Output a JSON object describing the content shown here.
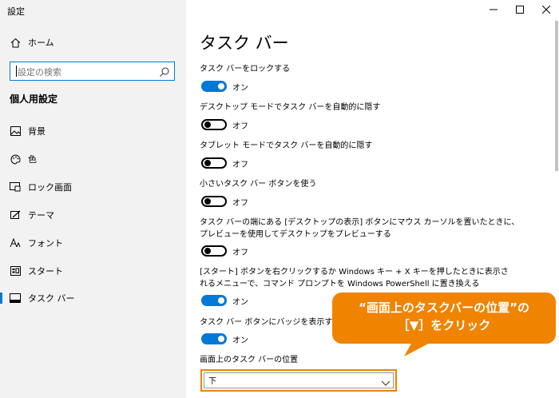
{
  "window": {
    "title": "設定"
  },
  "sidebar": {
    "home_label": "ホーム",
    "search_placeholder": "設定の検索",
    "section_title": "個人用設定",
    "items": [
      {
        "label": "背景",
        "icon": "picture-icon"
      },
      {
        "label": "色",
        "icon": "palette-icon"
      },
      {
        "label": "ロック画面",
        "icon": "lock-screen-icon"
      },
      {
        "label": "テーマ",
        "icon": "theme-icon"
      },
      {
        "label": "フォント",
        "icon": "font-icon"
      },
      {
        "label": "スタート",
        "icon": "start-icon"
      },
      {
        "label": "タスク バー",
        "icon": "taskbar-icon",
        "active": true
      }
    ]
  },
  "main": {
    "title": "タスク バー",
    "settings": [
      {
        "label": "タスク バーをロックする",
        "state": "オン"
      },
      {
        "label": "デスクトップ モードでタスク バーを自動的に隠す",
        "state": "オフ"
      },
      {
        "label": "タブレット モードでタスク バーを自動的に隠す",
        "state": "オフ"
      },
      {
        "label": "小さいタスク バー ボタンを使う",
        "state": "オフ"
      },
      {
        "label_lines": [
          "タスク バーの端にある [デスクトップの表示] ボタンにマウス カーソルを置いたときに、",
          "プレビューを使用してデスクトップをプレビューする"
        ],
        "state": "オフ"
      },
      {
        "label_lines": [
          "[スタート] ボタンを右クリックするか Windows キー + X キーを押したときに表示さ",
          "れるメニューで、コマンド プロンプトを Windows PowerShell に置き換える"
        ],
        "state": "オン"
      },
      {
        "label": "タスク バー ボタンにバッジを表示する",
        "state": "オン"
      }
    ],
    "position_label": "画面上のタスク バーの位置",
    "position_value": "下"
  },
  "callout": {
    "line1": "“画面上のタスクバーの位置”の",
    "line2": "［▼］をクリック"
  },
  "colors": {
    "accent": "#0078d7",
    "callout": "#f08300"
  }
}
